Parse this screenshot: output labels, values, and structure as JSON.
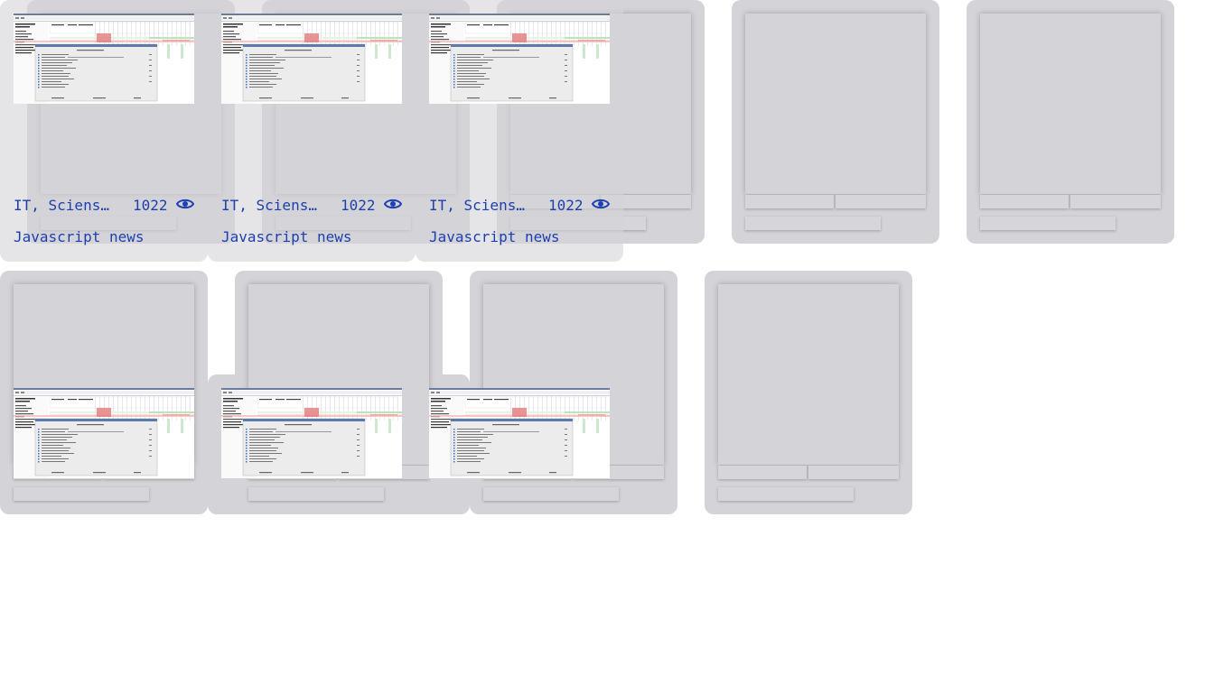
{
  "cards": [
    {
      "category": "IT, Sciens…",
      "views": "1022",
      "title": "Javascript news"
    },
    {
      "category": "IT, Sciens…",
      "views": "1022",
      "title": "Javascript news"
    },
    {
      "category": "IT, Sciens…",
      "views": "1022",
      "title": "Javascript news"
    }
  ],
  "icons": {
    "views": "eye-icon"
  },
  "colors": {
    "text": "#1e40af",
    "skeleton": "#d4d4d8",
    "background": "#ffffff"
  }
}
